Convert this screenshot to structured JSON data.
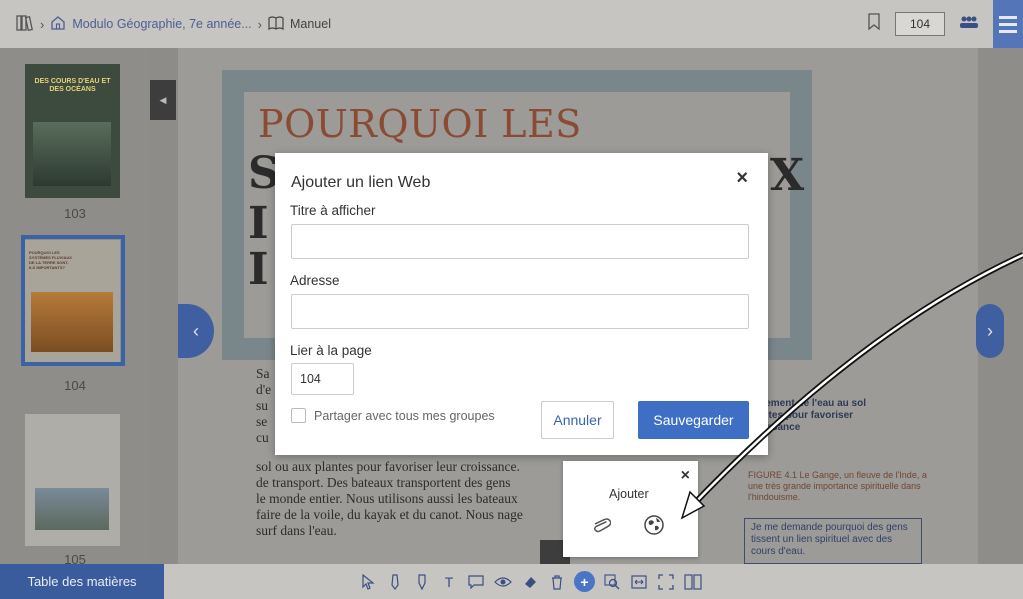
{
  "breadcrumb": {
    "course": "Modulo Géographie, 7e année...",
    "section": "Manuel"
  },
  "toolbar": {
    "page_number": "104"
  },
  "thumbnails": [
    {
      "page": "103",
      "cover_text": "DES COURS D'EAU ET DES OCÉANS"
    },
    {
      "page": "104",
      "cover_text": "POURQUOI LES SYSTÈMES FLUVIAUX DE LA TERRE SONT-ILS IMPORTANTS?"
    },
    {
      "page": "105"
    }
  ],
  "page": {
    "heading": "POURQUOI LES",
    "body_lines": [
      "sol ou aux plantes pour favoriser leur croissance.",
      "de transport. Des bateaux transportent des gens",
      "le monde entier. Nous utilisons aussi les bateaux",
      "faire de la voile, du kayak et du canot. Nous nage",
      "surf dans l'eau."
    ],
    "aside_lines": [
      "ficilement de l'eau au sol",
      "plantes pour favoriser",
      "croissance"
    ],
    "figure_caption": "FIGURE 4.1 Le Gange, un fleuve de l'Inde, a une très grande importance spirituelle dans l'hindouisme.",
    "note": "Je me demande pourquoi des gens tissent un lien spirituel avec des cours d'eau."
  },
  "modal": {
    "title": "Ajouter un lien Web",
    "title_field_label": "Titre à afficher",
    "title_field_value": "",
    "address_label": "Adresse",
    "address_value": "",
    "page_link_label": "Lier à la page",
    "page_link_value": "104",
    "share_label": "Partager avec tous mes groupes",
    "share_checked": false,
    "cancel_label": "Annuler",
    "save_label": "Sauvegarder"
  },
  "popover": {
    "title": "Ajouter",
    "icons": [
      "paperclip-icon",
      "globe-icon"
    ]
  },
  "bottom": {
    "toc_label": "Table des matières",
    "tools": [
      "cursor-icon",
      "pen-icon",
      "highlighter-icon",
      "text-icon",
      "comment-icon",
      "eye-icon",
      "eraser-icon",
      "trash-icon",
      "add-icon",
      "zoom-icon",
      "fit-width-icon",
      "fullscreen-icon",
      "two-page-icon"
    ]
  },
  "colors": {
    "accent": "#3f6ec5",
    "toc": "#3a5c9c",
    "menu": "#5476b8"
  }
}
